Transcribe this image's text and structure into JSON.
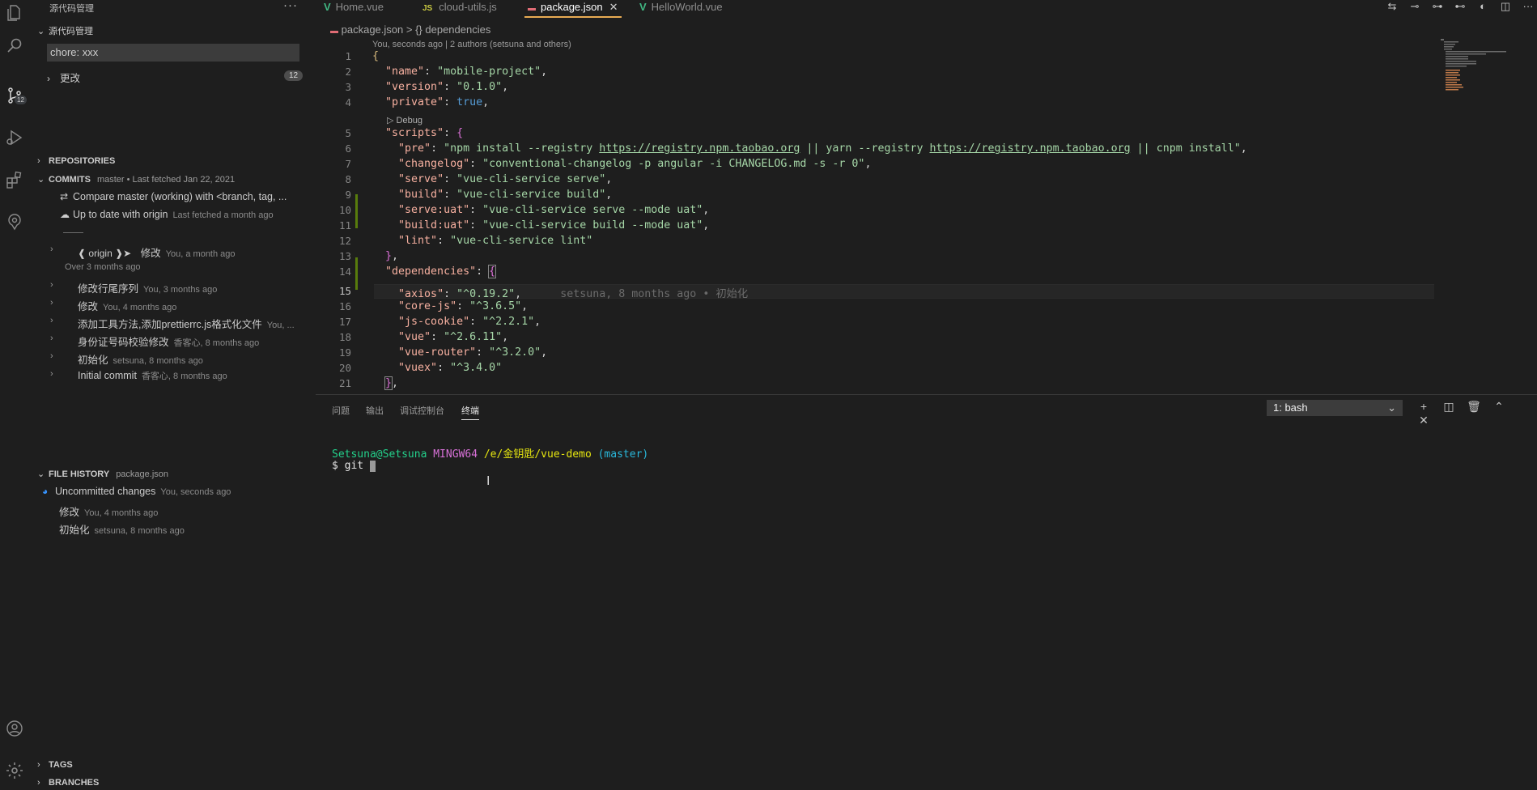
{
  "sidebar": {
    "title": "源代码管理",
    "section_title": "源代码管理",
    "commit_input": "chore: xxx",
    "changes_label": "更改",
    "changes_count": "12",
    "repositories": "REPOSITORIES",
    "commits": {
      "label": "COMMITS",
      "branch_info": "master • Last fetched Jan 22, 2021",
      "compare": "Compare master (working) with <branch, tag, ...",
      "uptodate": "Up to date with origin",
      "uptodate_meta": "Last fetched a month ago",
      "divider": "——",
      "origin_ref": "❰ origin ❱➤",
      "origin_msg": "修改",
      "origin_meta": "You, a month ago",
      "group": "Over 3 months ago",
      "items": [
        {
          "msg": "修改行尾序列",
          "meta": "You, 3 months ago"
        },
        {
          "msg": "修改",
          "meta": "You, 4 months ago"
        },
        {
          "msg": "添加工具方法,添加prettierrc.js格式化文件",
          "meta": "You, ..."
        },
        {
          "msg": "身份证号码校验修改",
          "meta": "香客心, 8 months ago"
        },
        {
          "msg": "初始化",
          "meta": "setsuna, 8 months ago"
        },
        {
          "msg": "Initial commit",
          "meta": "香客心, 8 months ago"
        }
      ]
    },
    "file_history": {
      "label": "FILE HISTORY",
      "file": "package.json",
      "items": [
        {
          "msg": "Uncommitted changes",
          "meta": "You, seconds ago"
        },
        {
          "msg": "修改",
          "meta": "You, 4 months ago"
        },
        {
          "msg": "初始化",
          "meta": "setsuna, 8 months ago"
        }
      ]
    },
    "tags": "TAGS",
    "branches": "BRANCHES"
  },
  "activity": {
    "scm_badge": "12"
  },
  "tabs": [
    {
      "label": "Home.vue"
    },
    {
      "label": "cloud-utils.js",
      "icon_text": "JS"
    },
    {
      "label": "package.json"
    },
    {
      "label": "HelloWorld.vue"
    }
  ],
  "breadcrumb": {
    "file": "package.json",
    "sep": ">",
    "symbol": "{} dependencies"
  },
  "blame_header": "You, seconds ago | 2 authors (setsuna and others)",
  "codelens": "▷ Debug",
  "inline_blame": "setsuna, 8 months ago • 初始化",
  "code": {
    "line_numbers": [
      "1",
      "2",
      "3",
      "4",
      "5",
      "6",
      "7",
      "8",
      "9",
      "10",
      "11",
      "12",
      "13",
      "14",
      "15",
      "16",
      "17",
      "18",
      "19",
      "20",
      "21"
    ],
    "name_key": "\"name\"",
    "name_val": "\"mobile-project\"",
    "version_key": "\"version\"",
    "version_val": "\"0.1.0\"",
    "private_key": "\"private\"",
    "private_val": "true",
    "scripts_key": "\"scripts\"",
    "pre_key": "\"pre\"",
    "pre_val_a": "\"npm install --registry ",
    "pre_url1": "https://registry.npm.taobao.org",
    "pre_val_b": " || yarn --registry ",
    "pre_url2": "https://registry.npm.taobao.org",
    "pre_val_c": " || cnpm install\"",
    "changelog_key": "\"changelog\"",
    "changelog_val": "\"conventional-changelog -p angular -i CHANGELOG.md -s -r 0\"",
    "serve_key": "\"serve\"",
    "serve_val": "\"vue-cli-service serve\"",
    "build_key": "\"build\"",
    "build_val": "\"vue-cli-service build\"",
    "serveuat_key": "\"serve:uat\"",
    "serveuat_val": "\"vue-cli-service serve --mode uat\"",
    "builduat_key": "\"build:uat\"",
    "builduat_val": "\"vue-cli-service build --mode uat\"",
    "lint_key": "\"lint\"",
    "lint_val": "\"vue-cli-service lint\"",
    "deps_key": "\"dependencies\"",
    "axios_key": "\"axios\"",
    "axios_val": "\"^0.19.2\"",
    "corejs_key": "\"core-js\"",
    "corejs_val": "\"^3.6.5\"",
    "jscookie_key": "\"js-cookie\"",
    "jscookie_val": "\"^2.2.1\"",
    "vue_key": "\"vue\"",
    "vue_val": "\"^2.6.11\"",
    "vuerouter_key": "\"vue-router\"",
    "vuerouter_val": "\"^3.2.0\"",
    "vuex_key": "\"vuex\"",
    "vuex_val": "\"^3.4.0\""
  },
  "panel": {
    "tabs": [
      "问题",
      "输出",
      "调试控制台",
      "终端"
    ],
    "terminal_select": "1: bash",
    "prompt_user": "Setsuna@Setsuna",
    "prompt_host": "MINGW64",
    "prompt_path": "/e/金钥匙/vue-demo",
    "prompt_branch": "(master)",
    "command": "$ git "
  }
}
